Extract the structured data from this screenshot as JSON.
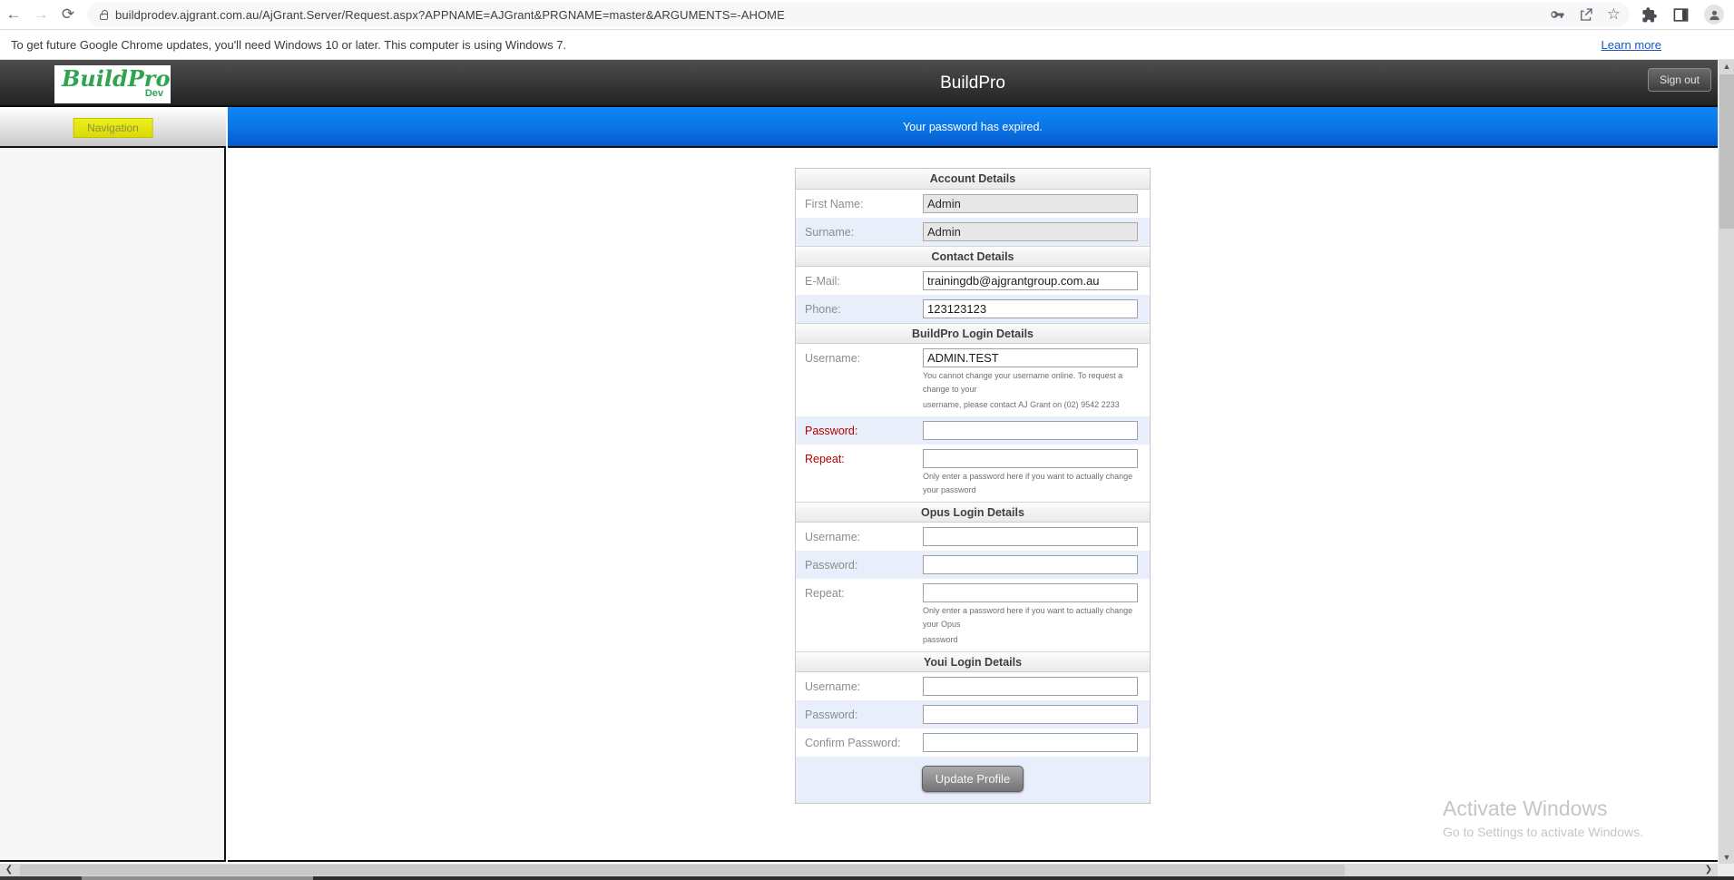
{
  "browser": {
    "toolbar": {
      "back_icon": "←",
      "forward_icon": "→",
      "reload_icon": "⟳",
      "star_icon": "☆",
      "url": "buildprodev.ajgrant.com.au/AjGrant.Server/Request.aspx?APPNAME=AJGrant&PRGNAME=master&ARGUMENTS=-AHOME"
    },
    "infobar": {
      "message": "To get future Google Chrome updates, you'll need Windows 10 or later. This computer is using Windows 7.",
      "link_label": "Learn more"
    }
  },
  "app": {
    "header": {
      "logo": "BuildPro",
      "logo_badge": "Dev",
      "title": "BuildPro",
      "signout_label": "Sign out"
    },
    "sidebar": {
      "nav_button": "Navigation"
    },
    "banner_message": "Your password has expired.",
    "watermark": {
      "title": "Activate Windows",
      "subtitle": "Go to Settings to activate Windows."
    },
    "form": {
      "submit_label": "Update Profile",
      "sections": [
        {
          "title": "Account Details",
          "rows": [
            {
              "label": "First Name:",
              "value": "Admin",
              "type": "text",
              "disabled": true
            },
            {
              "label": "Surname:",
              "value": "Admin",
              "type": "text",
              "disabled": true
            }
          ]
        },
        {
          "title": "Contact Details",
          "rows": [
            {
              "label": "E-Mail:",
              "value": "trainingdb@ajgrantgroup.com.au",
              "type": "text"
            },
            {
              "label": "Phone:",
              "value": "123123123",
              "type": "text"
            }
          ]
        },
        {
          "title": "BuildPro Login Details",
          "rows": [
            {
              "label": "Username:",
              "value": "ADMIN.TEST",
              "type": "text",
              "help": [
                "You cannot change your username online. To request a change to your",
                "username, please contact AJ Grant on (02) 9542 2233"
              ]
            },
            {
              "label": "Password:",
              "value": "",
              "type": "password",
              "label_red": true
            },
            {
              "label": "Repeat:",
              "value": "",
              "type": "password",
              "label_red": true,
              "help": [
                "Only enter a password here if you want to actually change your password"
              ]
            }
          ]
        },
        {
          "title": "Opus Login Details",
          "rows": [
            {
              "label": "Username:",
              "value": "",
              "type": "text"
            },
            {
              "label": "Password:",
              "value": "",
              "type": "password"
            },
            {
              "label": "Repeat:",
              "value": "",
              "type": "password",
              "help": [
                "Only enter a password here if you want to actually change your Opus",
                "password"
              ]
            }
          ]
        },
        {
          "title": "Youi Login Details",
          "rows": [
            {
              "label": "Username:",
              "value": "",
              "type": "text"
            },
            {
              "label": "Password:",
              "value": "",
              "type": "password"
            },
            {
              "label": "Confirm Password:",
              "value": "",
              "type": "password"
            }
          ]
        }
      ]
    }
  },
  "colors": {
    "banner_blue": "#0b74e4",
    "accent_green": "#2ea44f",
    "nav_yellow": "#e3e40f",
    "red_label": "#b30000",
    "header_dark": "#2e2e2e"
  }
}
